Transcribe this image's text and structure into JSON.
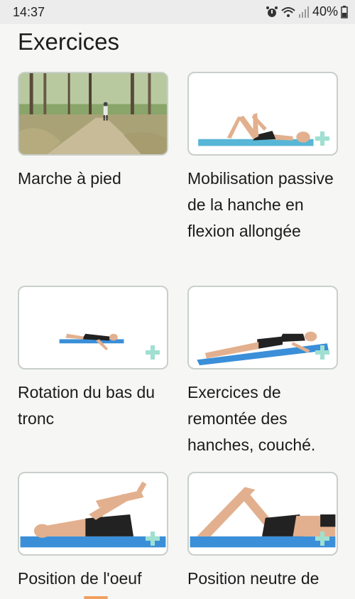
{
  "status": {
    "time": "14:37",
    "battery": "40%"
  },
  "page": {
    "title": "Exercices"
  },
  "exercises": [
    {
      "label": "Marche à pied",
      "icon": "forest-walk-photo"
    },
    {
      "label": "Mobilisation passive de la hanche en flexion allongée",
      "icon": "hip-flexion-photo"
    },
    {
      "label": "Rotation du bas du tronc",
      "icon": "trunk-rotation-photo"
    },
    {
      "label": "Exercices de remontée des hanches, couché.",
      "icon": "hip-raise-photo"
    },
    {
      "label": "Position de l'oeuf",
      "icon": "egg-position-photo"
    },
    {
      "label": "Position neutre de",
      "icon": "neutral-position-photo"
    }
  ],
  "colors": {
    "accent_plus": "#9fe0d1",
    "mat": "#3a8fd8",
    "mat_light": "#58b6d6"
  }
}
